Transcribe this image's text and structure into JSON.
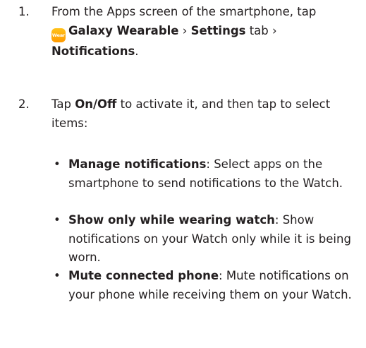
{
  "steps": [
    {
      "number": "1.",
      "prefix": "From the Apps screen of the smartphone, tap ",
      "icon": {
        "name": "wear-app-icon",
        "label": "Wear"
      },
      "app_name": "Galaxy Wearable",
      "separator1": " › ",
      "settings": "Settings",
      "tab_text": " tab ›",
      "notifications": "Notifications",
      "end": "."
    },
    {
      "number": "2.",
      "tap": "Tap ",
      "on_off": "On/Off",
      "rest": " to activate it, and then tap to select items:"
    }
  ],
  "bullets": [
    {
      "title": "Manage notifications",
      "text": ": Select apps on the smartphone to send notifications to the Watch."
    },
    {
      "title": "Show only while wearing watch",
      "text": ": Show notifications on your Watch only while it is being worn."
    },
    {
      "title": "Mute connected phone",
      "text": ": Mute notifications on your phone while receiving them on your Watch."
    }
  ],
  "bullet_glyph": "•",
  "colors": {
    "text": "#231f20",
    "icon_top": "#ffc21a",
    "icon_bottom": "#ff9a00"
  }
}
